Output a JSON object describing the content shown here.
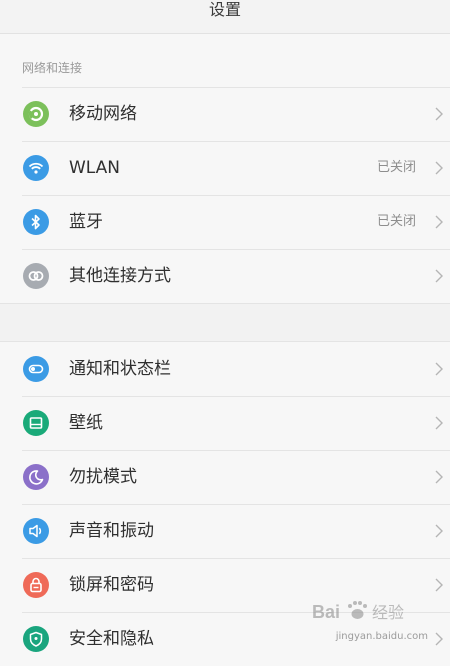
{
  "header": {
    "title": "设置"
  },
  "section": {
    "network_title": "网络和连接"
  },
  "rows": [
    {
      "label": "移动网络",
      "status": "",
      "icon": "mobile-network-icon",
      "color": "#7cc05b"
    },
    {
      "label": "WLAN",
      "status": "已关闭",
      "icon": "wifi-icon",
      "color": "#3b9be5"
    },
    {
      "label": "蓝牙",
      "status": "已关闭",
      "icon": "bluetooth-icon",
      "color": "#3b9be5"
    },
    {
      "label": "其他连接方式",
      "status": "",
      "icon": "link-icon",
      "color": "#a7abb1"
    },
    {
      "label": "通知和状态栏",
      "status": "",
      "icon": "toggle-icon",
      "color": "#3b9be5"
    },
    {
      "label": "壁纸",
      "status": "",
      "icon": "wallpaper-icon",
      "color": "#1aaa79"
    },
    {
      "label": "勿扰模式",
      "status": "",
      "icon": "moon-icon",
      "color": "#8b70c9"
    },
    {
      "label": "声音和振动",
      "status": "",
      "icon": "speaker-icon",
      "color": "#3b9be5"
    },
    {
      "label": "锁屏和密码",
      "status": "",
      "icon": "lock-icon",
      "color": "#ef6a58"
    },
    {
      "label": "安全和隐私",
      "status": "",
      "icon": "shield-icon",
      "color": "#1aa57e"
    }
  ],
  "watermark": {
    "logo": "Bai 经验",
    "url": "jingyan.baidu.com"
  }
}
